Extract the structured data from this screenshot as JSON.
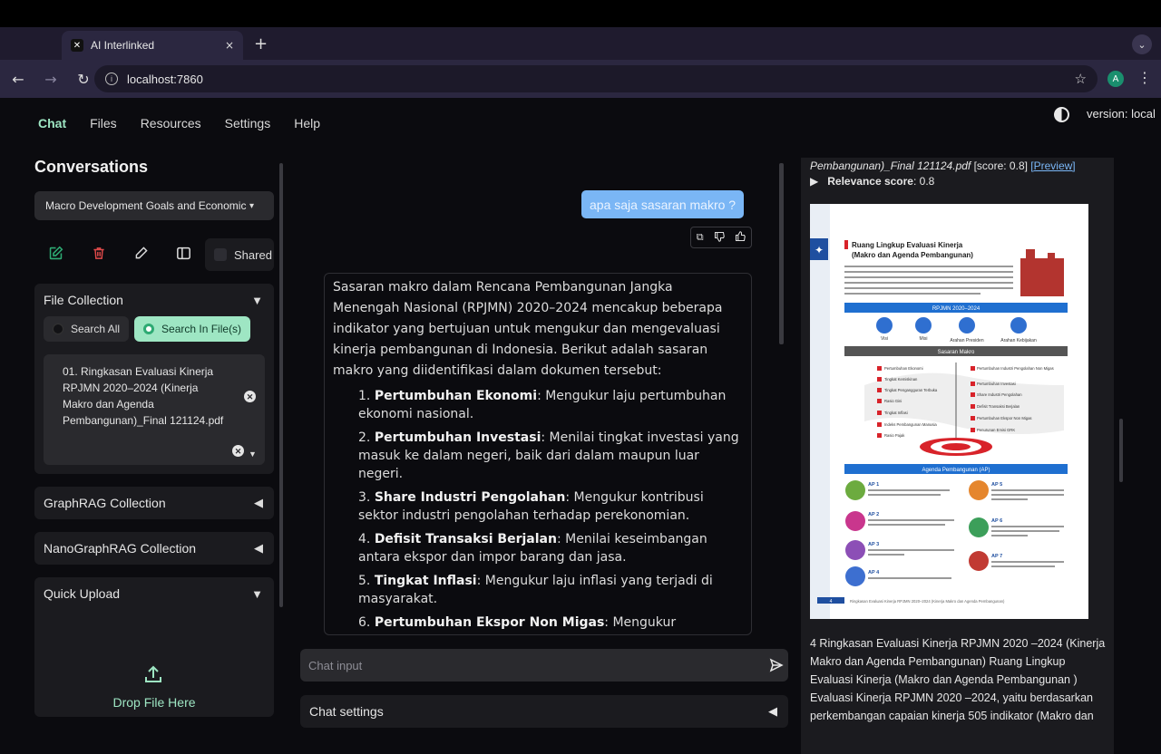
{
  "browser": {
    "tab_title": "AI Interlinked",
    "tab_close": "×",
    "new_tab": "+",
    "url": "localhost:7860",
    "profile_initial": "A"
  },
  "nav": {
    "items": [
      "Chat",
      "Files",
      "Resources",
      "Settings",
      "Help"
    ],
    "active": "Chat",
    "version": "version: local"
  },
  "sidebar": {
    "title": "Conversations",
    "selected_conversation": "Macro Development Goals and Economic",
    "shared_label": "Shared",
    "file_collection": {
      "title": "File Collection",
      "search_all": "Search All",
      "search_in_files": "Search In File(s)",
      "selected_file": "01. Ringkasan Evaluasi Kinerja RPJMN 2020–2024 (Kinerja Makro dan Agenda Pembangunan)_Final 121124.pdf"
    },
    "graphrag": "GraphRAG Collection",
    "nanographrag": "NanoGraphRAG Collection",
    "quick_upload": "Quick Upload",
    "drop_text": "Drop File Here"
  },
  "chat": {
    "user_message": "apa saja sasaran makro ?",
    "bot_intro": "Sasaran makro dalam Rencana Pembangunan Jangka Menengah Nasional (RPJMN) 2020–2024 mencakup beberapa indikator yang bertujuan untuk mengukur dan mengevaluasi kinerja pembangunan di Indonesia. Berikut adalah sasaran makro yang diidentifikasi dalam dokumen tersebut:",
    "items": [
      {
        "num": "1. ",
        "title": "Pertumbuhan Ekonomi",
        "desc": ": Mengukur laju pertumbuhan ekonomi nasional."
      },
      {
        "num": "2. ",
        "title": "Pertumbuhan Investasi",
        "desc": ": Menilai tingkat investasi yang masuk ke dalam negeri, baik dari dalam maupun luar negeri."
      },
      {
        "num": "3. ",
        "title": "Share Industri Pengolahan",
        "desc": ": Mengukur kontribusi sektor industri pengolahan terhadap perekonomian."
      },
      {
        "num": "4. ",
        "title": "Defisit Transaksi Berjalan",
        "desc": ": Menilai keseimbangan antara ekspor dan impor barang dan jasa."
      },
      {
        "num": "5. ",
        "title": "Tingkat Inflasi",
        "desc": ": Mengukur laju inflasi yang terjadi di masyarakat."
      },
      {
        "num": "6. ",
        "title": "Pertumbuhan Ekspor Non Migas",
        "desc": ": Mengukur pertumbuhan ekspor barang non-migas."
      }
    ],
    "input_placeholder": "Chat input",
    "settings_label": "Chat settings"
  },
  "evidence": {
    "source_name": "Pembangunan)_Final 121124.pdf",
    "score_text": " [score: 0.8] ",
    "preview_link": "[Preview]",
    "relevance_label": "Relevance score",
    "relevance_value": ": 0.8",
    "doc": {
      "heading1": "Ruang Lingkup Evaluasi Kinerja",
      "heading2": "(Makro dan Agenda Pembangunan)",
      "band1": "RPJMN 2020–2024",
      "icons": [
        "Visi",
        "Misi",
        "Arahan Presiden",
        "Arahan Kebijakan"
      ],
      "band2": "Sasaran Makro",
      "band3": "Agenda Pembangunan (AP)",
      "macro_left": [
        "Pertumbuhan Ekonomi",
        "Tingkat Kemiskinan",
        "Tingkat Pengangguran Terbuka",
        "Rasio Gini",
        "Tingkat Inflasi",
        "Indeks Pembangunan Manusia",
        "Rasio Pajak"
      ],
      "macro_right": [
        "Pertumbuhan Industri Pengolahan Non Migas",
        "Pertumbuhan Investasi",
        "Share Industri Pengolahan",
        "Defisit Transaksi Berjalan",
        "Pertumbuhan Ekspor Non Migas",
        "Penurunan Emisi GRK"
      ],
      "ap_left": [
        "AP 1",
        "AP 2",
        "AP 3",
        "AP 4"
      ],
      "ap_right": [
        "AP 5",
        "AP 6",
        "AP 7"
      ],
      "footer_num": "4",
      "footer": "Ringkasan Evaluasi Kinerja RPJMN 2020–2024 (Kinerja Makro dan Agenda Pembangunan)"
    },
    "text": "4 Ringkasan Evaluasi Kinerja RPJMN 2020 –2024 (Kinerja Makro dan Agenda Pembangunan) Ruang Lingkup Evaluasi Kinerja (Makro dan Agenda Pembangunan ) Evaluasi Kinerja RPJMN 2020 –2024, yaitu berdasarkan perkembangan capaian kinerja 505 indikator (Makro dan"
  },
  "colors": {
    "accent": "#9ee6c3",
    "user_bubble": "#7ab6f5",
    "panel": "#1b1b1f",
    "danger": "#e04a4a"
  }
}
